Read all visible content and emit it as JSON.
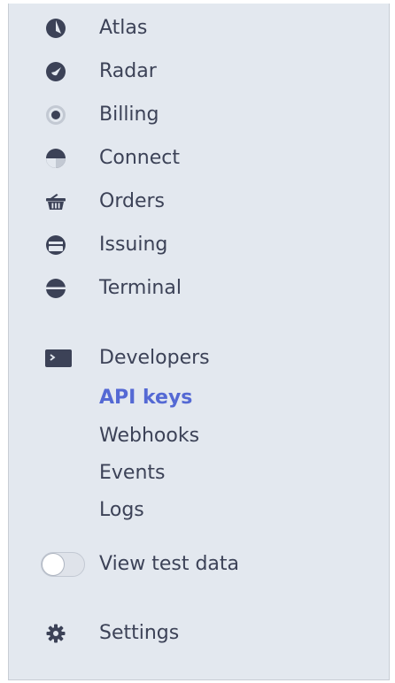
{
  "sidebar": {
    "items": [
      {
        "label": "Atlas",
        "icon": "atlas-icon"
      },
      {
        "label": "Radar",
        "icon": "radar-icon"
      },
      {
        "label": "Billing",
        "icon": "billing-icon"
      },
      {
        "label": "Connect",
        "icon": "connect-icon"
      },
      {
        "label": "Orders",
        "icon": "orders-basket-icon"
      },
      {
        "label": "Issuing",
        "icon": "issuing-card-icon"
      },
      {
        "label": "Terminal",
        "icon": "terminal-reader-icon"
      }
    ],
    "developers": {
      "label": "Developers",
      "icon": "developers-console-icon",
      "subitems": [
        {
          "label": "API keys",
          "active": true
        },
        {
          "label": "Webhooks",
          "active": false
        },
        {
          "label": "Events",
          "active": false
        },
        {
          "label": "Logs",
          "active": false
        }
      ]
    },
    "test_data_toggle": {
      "label": "View test data",
      "on": false
    },
    "settings": {
      "label": "Settings",
      "icon": "gear-icon"
    }
  },
  "colors": {
    "background": "#e3e8ef",
    "text": "#3c4257",
    "icon": "#3c4257",
    "active": "#5469d4"
  }
}
